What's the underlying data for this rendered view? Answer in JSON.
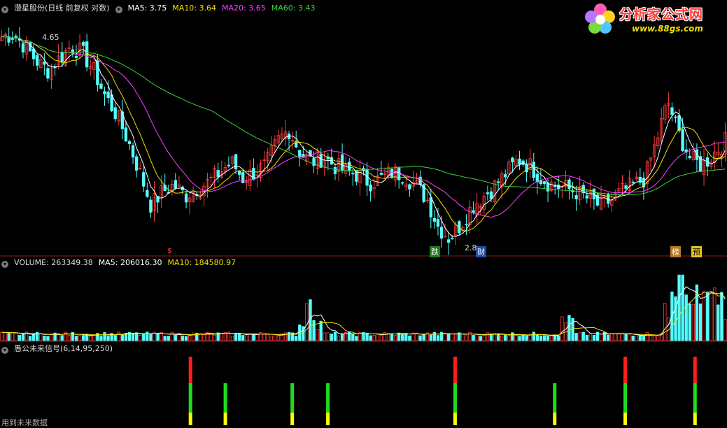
{
  "main_header": {
    "title": "澄星股份(日线 前复权 对数)",
    "ma5": "MA5: 3.75",
    "ma10": "MA10: 3.64",
    "ma20": "MA20: 3.65",
    "ma60": "MA60: 3.43"
  },
  "volume_header": {
    "volume": "VOLUME: 263349.38",
    "ma5": "MA5: 206016.30",
    "ma10": "MA10: 184580.97"
  },
  "signal_header": {
    "title": "愚公未来信号(6,14,95,250)"
  },
  "footer_label": "用到未来数据",
  "logo": {
    "text": "分析家公式网",
    "url": "www.88gs.com"
  },
  "colors": {
    "up": "#ff3c3c",
    "down": "#54ffff",
    "ma5": "#ffffff",
    "ma10": "#f0e000",
    "ma20": "#ff40ff",
    "ma60": "#3cd23c",
    "signal_red": "#ff1e1e",
    "signal_green": "#1edc1e",
    "signal_yellow": "#ffff00"
  },
  "chart_data": [
    {
      "type": "candlestick",
      "panel": "price",
      "scale": "log",
      "ylim": [
        2.8,
        4.8
      ],
      "annotations": [
        {
          "text": "4.65",
          "kind": "high"
        },
        {
          "text": "2.8",
          "kind": "low"
        }
      ],
      "event_labels": [
        "$",
        "跌",
        "财",
        "榜",
        "预"
      ],
      "close_path": [
        4.55,
        4.58,
        4.45,
        4.3,
        4.2,
        4.32,
        4.45,
        4.38,
        4.2,
        3.95,
        3.78,
        3.55,
        3.3,
        3.05,
        3.15,
        3.2,
        3.12,
        3.18,
        3.22,
        3.3,
        3.38,
        3.25,
        3.3,
        3.35,
        3.55,
        3.65,
        3.45,
        3.38,
        3.42,
        3.35,
        3.3,
        3.28,
        3.22,
        3.25,
        3.3,
        3.28,
        3.2,
        3.1,
        2.9,
        2.82,
        2.92,
        3.05,
        3.12,
        3.2,
        3.3,
        3.4,
        3.35,
        3.25,
        3.2,
        3.18,
        3.15,
        3.1,
        3.05,
        3.08,
        3.15,
        3.2,
        3.25,
        3.55,
        3.9,
        3.6,
        3.4,
        3.35,
        3.45,
        3.55
      ],
      "series": [
        "MA5",
        "MA10",
        "MA20",
        "MA60"
      ]
    },
    {
      "type": "bar",
      "panel": "volume",
      "series": [
        "VOLUME",
        "MA5",
        "MA10"
      ],
      "ylim": [
        0,
        270000
      ]
    },
    {
      "type": "signal",
      "panel": "indicator",
      "signals": [
        {
          "pos": 0.262,
          "levels": [
            "red",
            "green",
            "yellow"
          ]
        },
        {
          "pos": 0.31,
          "levels": [
            "green",
            "yellow"
          ]
        },
        {
          "pos": 0.402,
          "levels": [
            "green",
            "yellow"
          ]
        },
        {
          "pos": 0.451,
          "levels": [
            "green",
            "yellow"
          ]
        },
        {
          "pos": 0.626,
          "levels": [
            "red",
            "green",
            "yellow"
          ]
        },
        {
          "pos": 0.763,
          "levels": [
            "green",
            "yellow"
          ]
        },
        {
          "pos": 0.86,
          "levels": [
            "red",
            "green",
            "yellow"
          ]
        },
        {
          "pos": 0.956,
          "levels": [
            "red",
            "green",
            "yellow"
          ]
        }
      ]
    }
  ]
}
